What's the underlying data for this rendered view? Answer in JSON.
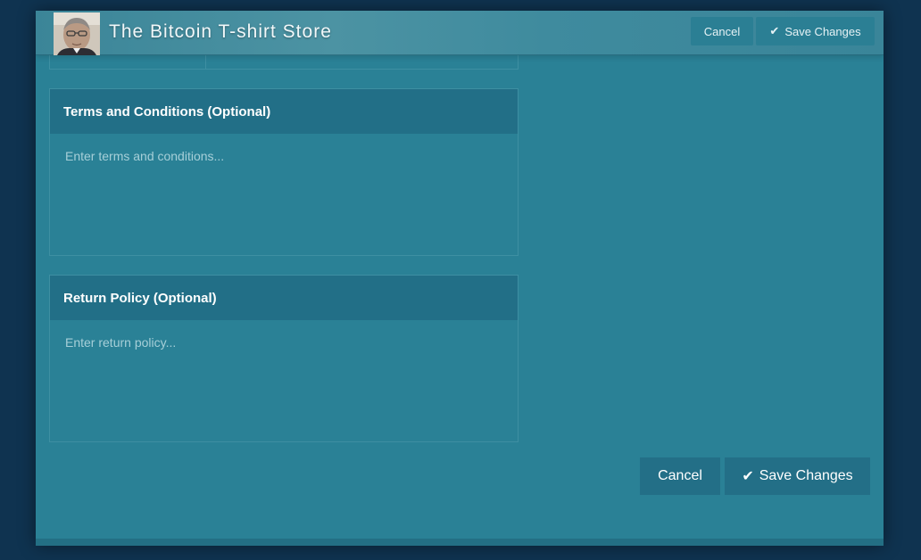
{
  "header": {
    "store_name": "The Bitcoin T-shirt Store",
    "cancel_label": "Cancel",
    "save_label": "Save Changes"
  },
  "terms": {
    "title": "Terms and Conditions (Optional)",
    "placeholder": "Enter terms and conditions...",
    "value": ""
  },
  "return_policy": {
    "title": "Return Policy (Optional)",
    "placeholder": "Enter return policy...",
    "value": ""
  },
  "footer": {
    "cancel_label": "Cancel",
    "save_label": "Save Changes"
  },
  "icons": {
    "checkmark": "check-icon"
  },
  "colors": {
    "page_bg": "#0f3350",
    "window_bg": "#2a8196",
    "panel_header": "#226f87",
    "button_bg": "#236f87"
  }
}
